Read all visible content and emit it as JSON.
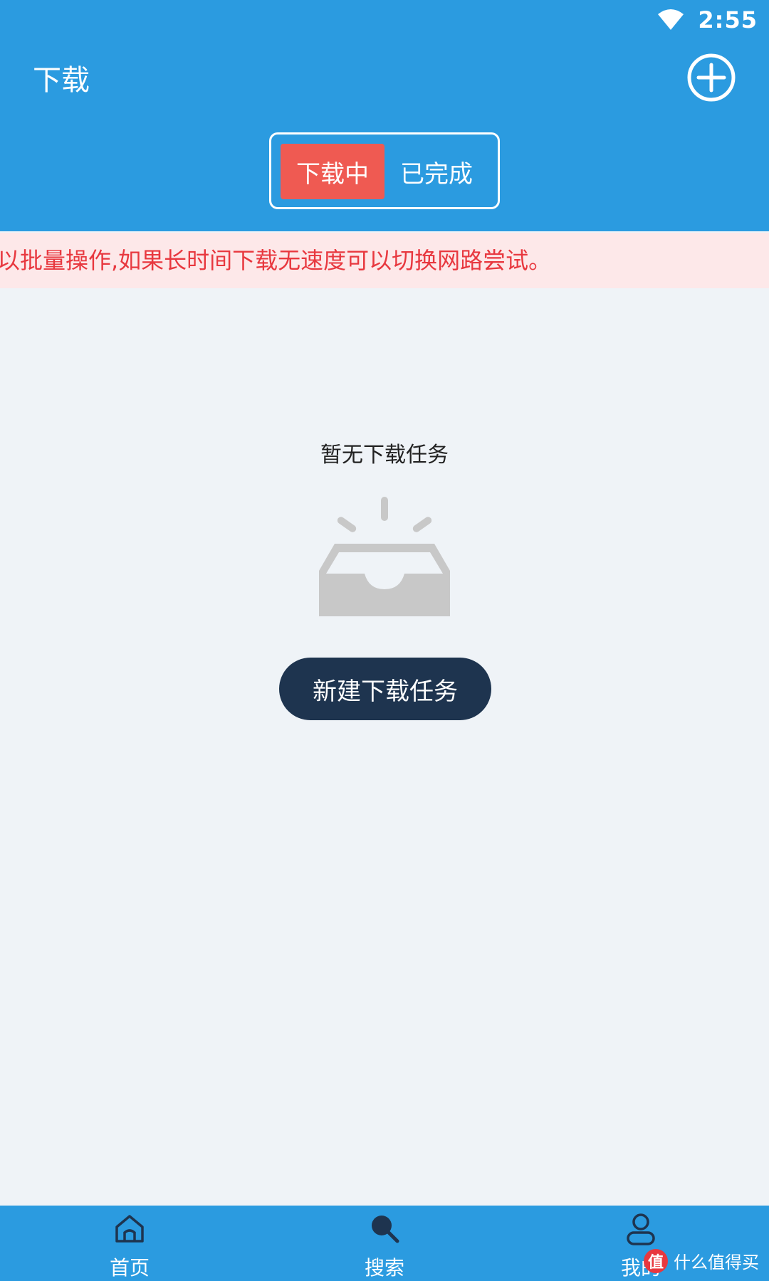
{
  "status_bar": {
    "time": "2:55",
    "wifi_icon": "wifi-icon"
  },
  "header": {
    "title": "下载",
    "add_icon": "plus-circle-icon"
  },
  "tabs": [
    {
      "label": "下载中",
      "active": true
    },
    {
      "label": "已完成",
      "active": false
    }
  ],
  "notice": {
    "text": "以批量操作,如果长时间下载无速度可以切换网路尝试。"
  },
  "empty_state": {
    "text": "暂无下载任务",
    "icon": "empty-inbox-icon",
    "button_label": "新建下载任务"
  },
  "bottom_nav": {
    "items": [
      {
        "label": "首页",
        "icon": "home-icon"
      },
      {
        "label": "搜索",
        "icon": "search-icon"
      },
      {
        "label": "我的",
        "icon": "user-icon"
      }
    ]
  },
  "watermark": {
    "logo_text": "值",
    "text": "什么值得买"
  },
  "colors": {
    "primary": "#2b9be0",
    "accent_red": "#ef5a52",
    "button_dark": "#1e344f",
    "notice_bg": "#fde8e9",
    "notice_text": "#e8383f",
    "page_bg": "#eff3f7"
  }
}
